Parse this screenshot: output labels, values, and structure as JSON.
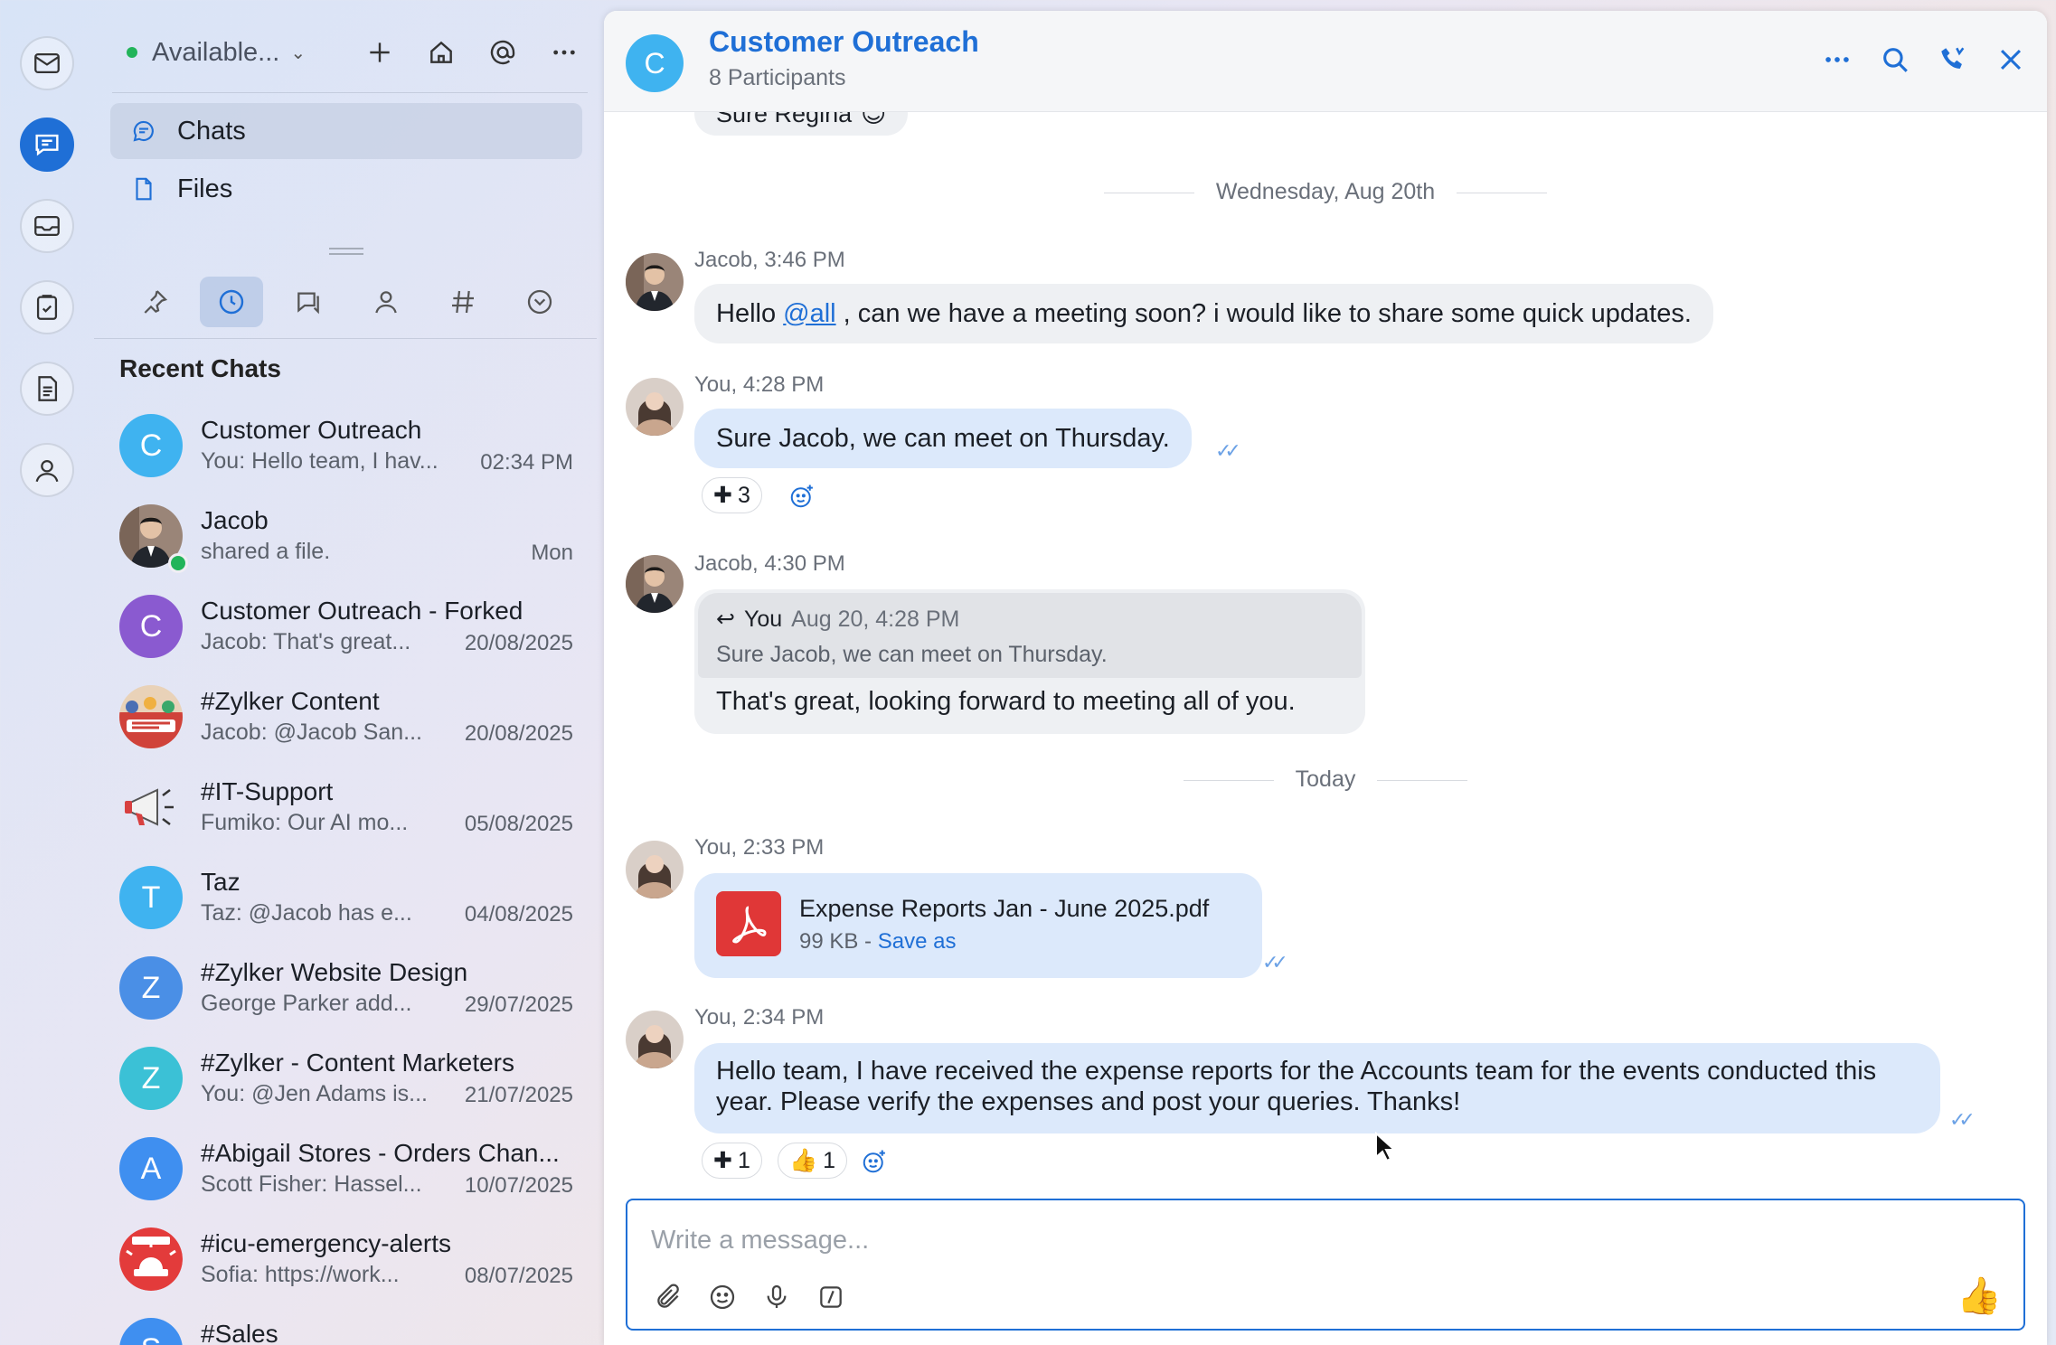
{
  "colors": {
    "accent": "#1f6fd6",
    "online": "#22b45a",
    "bubble_out": "#dce9fb",
    "bubble_in": "#eef0f3"
  },
  "rail": {
    "icons": [
      "mail-icon",
      "chat-icon",
      "inbox-icon",
      "tasks-icon",
      "notes-icon",
      "contacts-icon"
    ]
  },
  "sidebar": {
    "status": "Available...",
    "nav": [
      {
        "label": "Chats"
      },
      {
        "label": "Files"
      }
    ],
    "recent_title": "Recent Chats",
    "chats": [
      {
        "name": "Customer Outreach",
        "preview": "You: Hello team, I hav...",
        "time": "02:34 PM",
        "initial": "C",
        "color": "#3fb3f0"
      },
      {
        "name": "Jacob",
        "preview": "shared a file.",
        "time": "Mon",
        "initial": "",
        "color": "#6b5a4d"
      },
      {
        "name": "Customer Outreach - Forked",
        "preview": "Jacob: That's great...",
        "time": "20/08/2025",
        "initial": "C",
        "color": "#8a5ad0"
      },
      {
        "name": "#Zylker Content",
        "preview": "Jacob: @Jacob San...",
        "time": "20/08/2025",
        "initial": "",
        "color": "#e46b4f"
      },
      {
        "name": "#IT-Support",
        "preview": "Fumiko: Our AI mo...",
        "time": "05/08/2025",
        "initial": "",
        "color": "#f1f1f1"
      },
      {
        "name": "Taz",
        "preview": "Taz: @Jacob  has e...",
        "time": "04/08/2025",
        "initial": "T",
        "color": "#3fb3f0"
      },
      {
        "name": "#Zylker Website Design",
        "preview": "George Parker add...",
        "time": "29/07/2025",
        "initial": "Z",
        "color": "#4a8fe6"
      },
      {
        "name": "#Zylker - Content Marketers",
        "preview": "You: @Jen Adams  is...",
        "time": "21/07/2025",
        "initial": "Z",
        "color": "#3bc1d6"
      },
      {
        "name": "#Abigail Stores - Orders Chan...",
        "preview": "Scott Fisher: Hassel...",
        "time": "10/07/2025",
        "initial": "A",
        "color": "#3f8ff0"
      },
      {
        "name": "#icu-emergency-alerts",
        "preview": "Sofia: https://work...",
        "time": "08/07/2025",
        "initial": "",
        "color": "#e33b3b"
      },
      {
        "name": "#Sales",
        "preview": "",
        "time": "",
        "initial": "S",
        "color": "#3f8ff0"
      }
    ]
  },
  "chat": {
    "title": "Customer Outreach",
    "subtitle": "8 Participants",
    "avatar_initial": "C",
    "partial_text": "Sure Regina",
    "day1": "Wednesday, Aug 20th",
    "day2": "Today",
    "m1": {
      "meta": "Jacob, 3:46 PM",
      "pre": "Hello ",
      "mention": "@all",
      "post": " , can we have a meeting soon? i would like to share some quick updates."
    },
    "m2": {
      "meta": "You, 4:28 PM",
      "text": "Sure Jacob, we can meet on Thursday.",
      "reaction": "3"
    },
    "m3": {
      "meta": "Jacob, 4:30 PM",
      "quote_author": "You",
      "quote_date": "Aug 20, 4:28 PM",
      "quote_text": "Sure Jacob, we can meet on Thursday.",
      "text": "That's great, looking forward to meeting all of you."
    },
    "m4": {
      "meta": "You, 2:33 PM",
      "file_name": "Expense Reports Jan - June 2025.pdf",
      "file_size": "99 KB - ",
      "save_as": "Save as"
    },
    "m5": {
      "meta": "You, 2:34 PM",
      "text": "Hello team, I have received the expense reports for the Accounts team for the events conducted this year. Please verify the expenses and post your queries. Thanks!",
      "reaction_plus": "1",
      "reaction_thumb": "1"
    },
    "composer_placeholder": "Write a message..."
  }
}
